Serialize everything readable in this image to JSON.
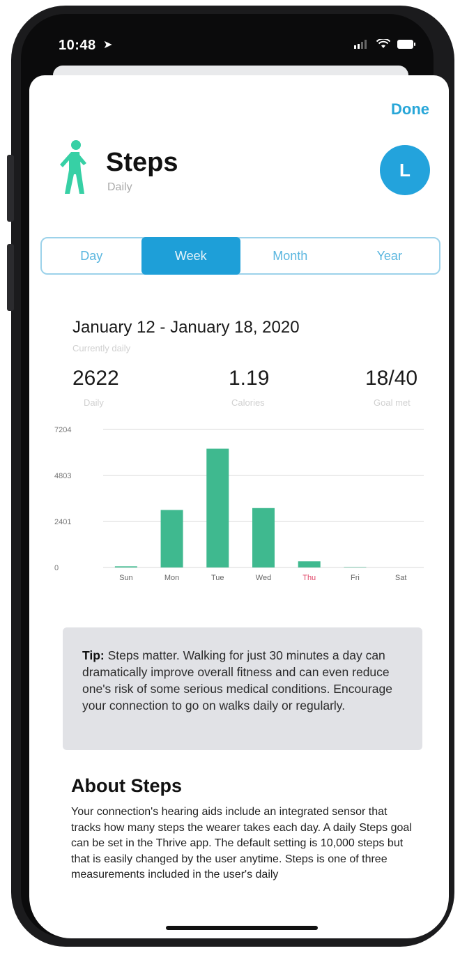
{
  "status_bar": {
    "time": "10:48"
  },
  "header": {
    "done_label": "Done",
    "title": "Steps",
    "subtitle": "Daily",
    "avatar_initial": "L"
  },
  "segments": [
    {
      "label": "Day",
      "active": false
    },
    {
      "label": "Week",
      "active": true
    },
    {
      "label": "Month",
      "active": false
    },
    {
      "label": "Year",
      "active": false
    }
  ],
  "summary": {
    "date_range": "January 12 - January 18, 2020",
    "date_range_sub": "Currently daily",
    "stats": [
      {
        "value": "2622",
        "label": "Daily"
      },
      {
        "value": "1.19",
        "label": "Calories"
      },
      {
        "value": "18/40",
        "label": "Goal met"
      }
    ]
  },
  "chart_data": {
    "type": "bar",
    "categories": [
      "Sun",
      "Mon",
      "Tue",
      "Wed",
      "Thu",
      "Fri",
      "Sat"
    ],
    "values": [
      60,
      3000,
      6200,
      3100,
      320,
      20,
      0
    ],
    "ylim": [
      0,
      7204
    ],
    "yticks": [
      0,
      2401,
      4803,
      7204
    ],
    "ytick_labels": [
      "0",
      "2401",
      "4803",
      "7204"
    ],
    "grid": true,
    "bar_color": "#3fb98f",
    "highlight_category": "Thu",
    "highlight_color": "#e0486a"
  },
  "tip": {
    "label": "Tip:",
    "text": " Steps matter. Walking for just 30 minutes a day can dramatically improve overall fitness and can even reduce one's risk of some serious medical conditions. Encourage your connection to go on walks daily or regularly."
  },
  "about": {
    "title": "About Steps",
    "body": "Your connection's hearing aids include an integrated sensor that tracks how many steps the wearer takes each day. A daily Steps goal can be set in the Thrive app. The default setting is 10,000 steps but that is easily changed by the user anytime. Steps is one of three measurements included in the user's daily"
  },
  "colors": {
    "accent": "#27a6d8",
    "bar": "#3fb98f",
    "steps_icon": "#37d0a5"
  }
}
